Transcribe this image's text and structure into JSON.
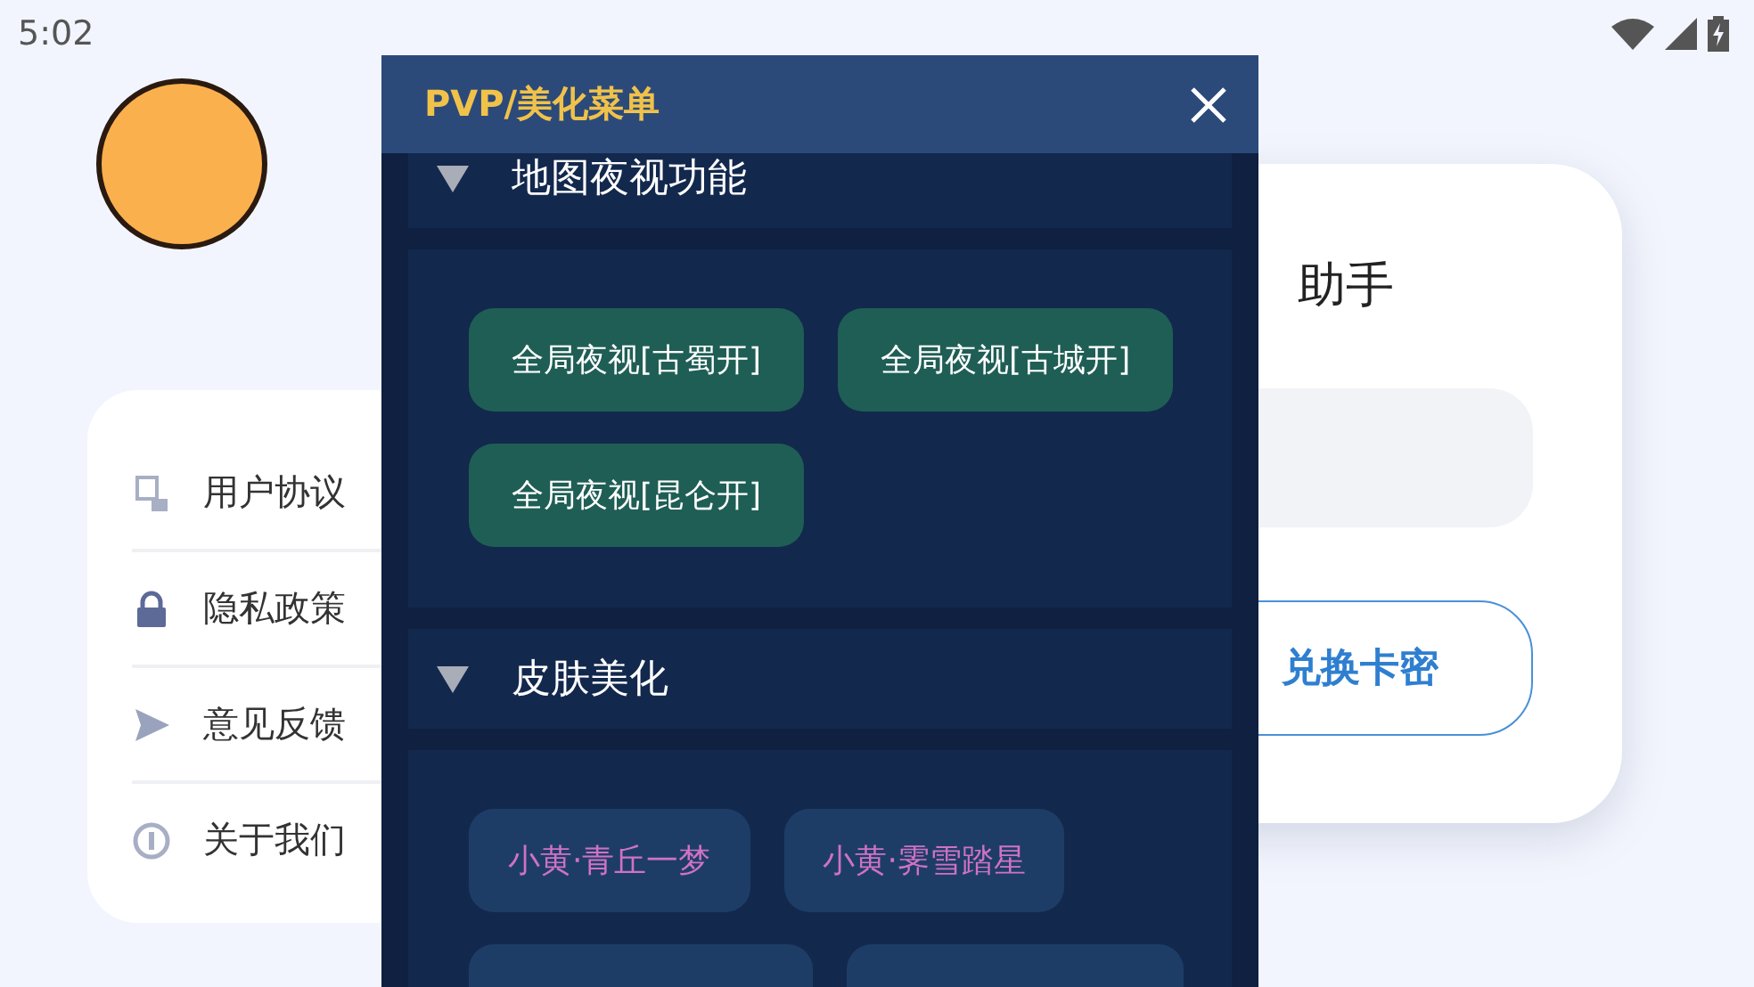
{
  "status_bar": {
    "time": "5:02"
  },
  "menu": {
    "items": [
      {
        "label": "用户协议",
        "kind": "document"
      },
      {
        "label": "隐私政策",
        "kind": "lock"
      },
      {
        "label": "意见反馈",
        "kind": "send"
      },
      {
        "label": "关于我们",
        "kind": "info"
      }
    ]
  },
  "activation_card": {
    "title": "助手",
    "button": "兑换卡密"
  },
  "panel": {
    "title": "PVP/美化菜单",
    "sections": [
      {
        "title": "地图夜视功能",
        "expanded": true,
        "kind": "feature",
        "buttons": [
          {
            "label": "全局夜视[古蜀开]"
          },
          {
            "label": "全局夜视[古城开]"
          },
          {
            "label": "全局夜视[昆仑开]"
          }
        ]
      },
      {
        "title": "皮肤美化",
        "expanded": true,
        "kind": "skin",
        "buttons": [
          {
            "label": "小黄·青丘一梦"
          },
          {
            "label": "小黄·霁雪踏星"
          },
          {
            "cut_off": true
          },
          {
            "cut_off": true
          }
        ]
      }
    ]
  }
}
